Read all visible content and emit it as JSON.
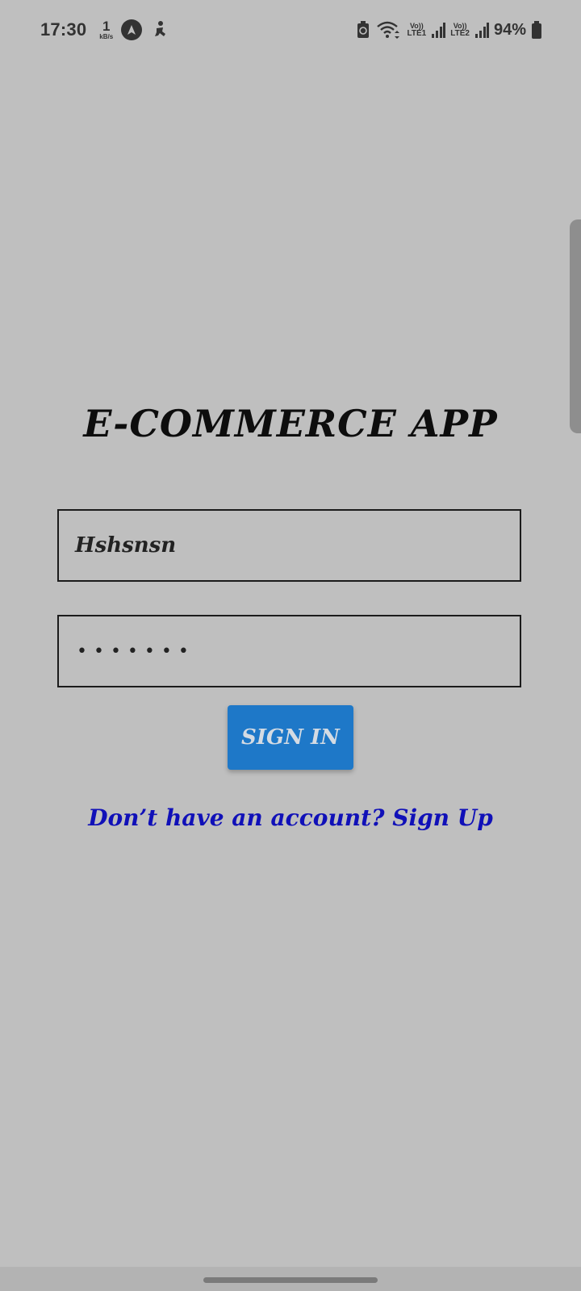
{
  "status_bar": {
    "time": "17:30",
    "speed_value": "1",
    "speed_unit": "kB/s",
    "sim1_top": "Vo))",
    "sim1_bottom": "LTE1",
    "sim2_top": "Vo))",
    "sim2_bottom": "LTE2",
    "battery": "94%",
    "icons": [
      "navigation-app-icon",
      "fitness-app-icon",
      "battery-saver-icon",
      "wifi-icon",
      "signal-icon",
      "battery-icon"
    ]
  },
  "login": {
    "title": "E-COMMERCE APP",
    "username_value": "Hshsnsn",
    "password_mask": "•••••••",
    "sign_in_label": "SIGN IN",
    "signup_prompt": "Don’t have an account? Sign Up"
  },
  "colors": {
    "background": "#bfbfbf",
    "button": "#1e78c8",
    "link": "#1010b8"
  }
}
